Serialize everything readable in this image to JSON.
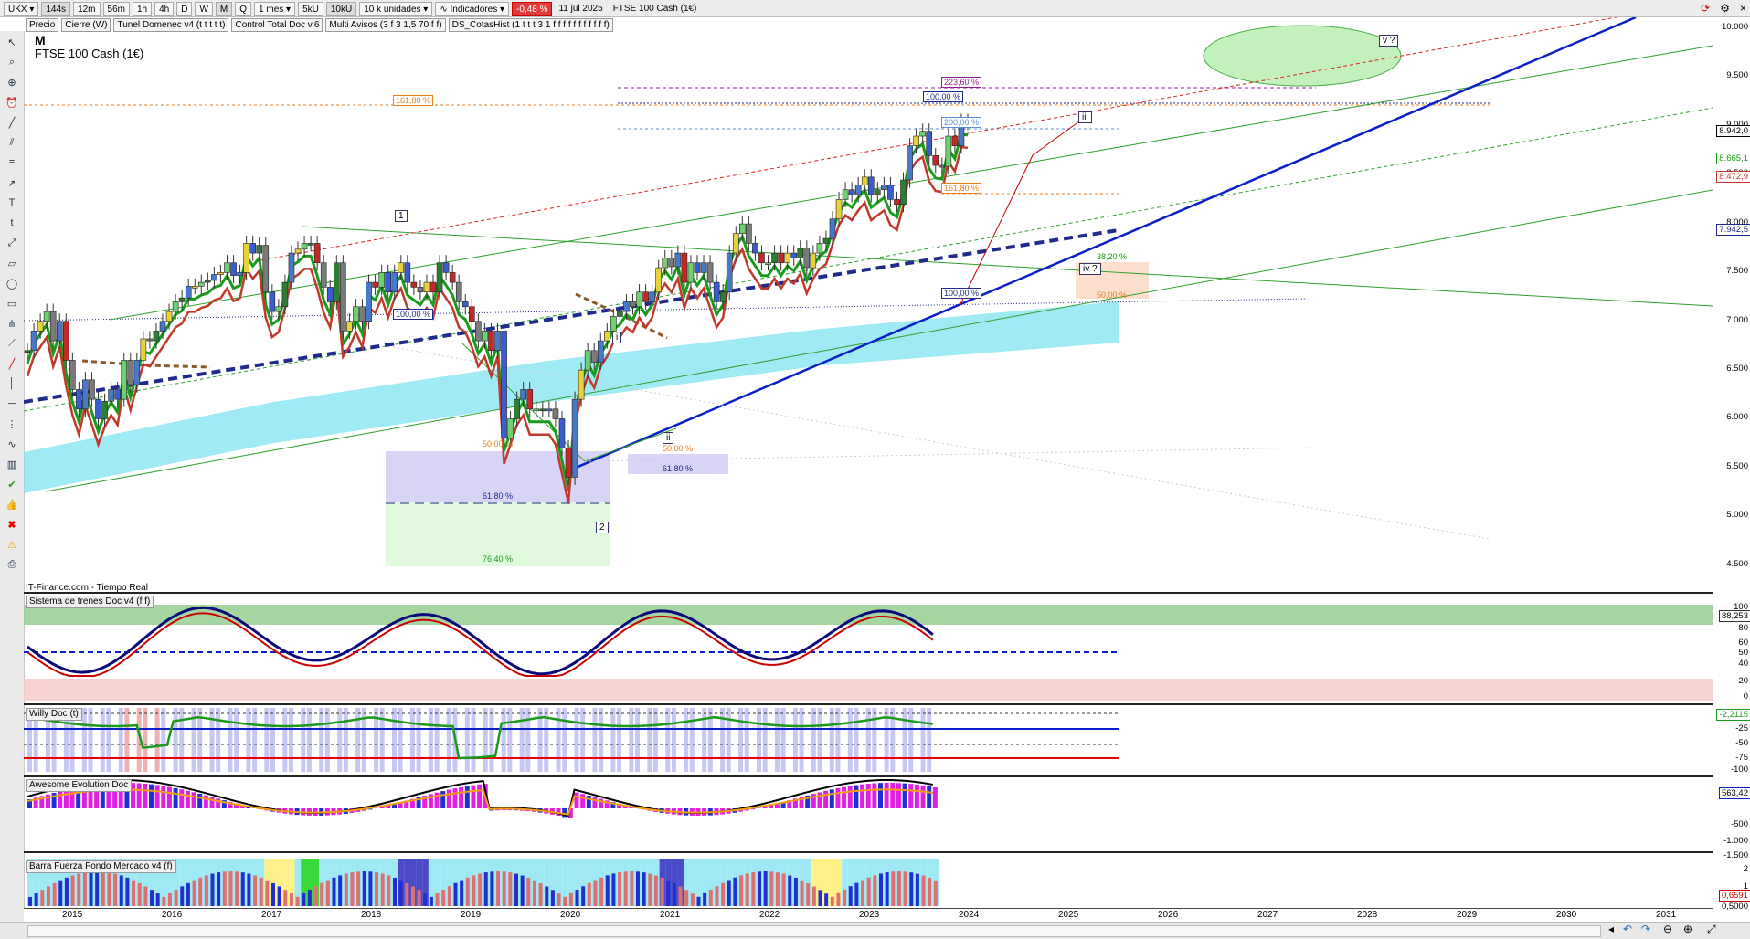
{
  "toolbar": {
    "symbol": "UKX",
    "timeframes": [
      "144s",
      "12m",
      "56m",
      "1h",
      "4h",
      "D",
      "W",
      "M",
      "Q"
    ],
    "period": "1 mes",
    "units_a": "5kU",
    "units_b": "10kU",
    "units_select": "10 k unidades",
    "indicators_label": "Indicadores",
    "change": "-0,48 %",
    "date": "11 jul 2025",
    "instrument": "FTSE 100 Cash (1€)"
  },
  "indicator_bar": [
    "Precio",
    "Cierre (W)",
    "Tunel Domenec v4 (t t t t t)",
    "Control Total Doc v.6",
    "Multi Avisos (3 f 3 1,5 70 f f)",
    "DS_CotasHist (1 t t t 3 1 f f f f f f f f f f f)"
  ],
  "chart": {
    "period_code": "M",
    "name": "FTSE 100 Cash (1€)",
    "source": "IT-Finance.com - Tiempo Real",
    "price_axis": [
      "10.000",
      "9.500",
      "9.000",
      "8.500",
      "8.000",
      "7.500",
      "7.000",
      "6.500",
      "6.000",
      "5.500",
      "5.000",
      "4.500"
    ],
    "price_tags": [
      {
        "text": "8.942,0",
        "color": "#000000"
      },
      {
        "text": "8.665,1",
        "color": "#1a9a1a"
      },
      {
        "text": "8.472,9",
        "color": "#c0392b"
      },
      {
        "text": "7.942,5",
        "color": "#1f2a8a"
      }
    ],
    "fib_labels": [
      {
        "text": "161,80 %",
        "color": "#e67e22"
      },
      {
        "text": "223,60 %",
        "color": "#8e1e8e"
      },
      {
        "text": "100,00 %",
        "color": "#1f2a8a"
      },
      {
        "text": "200,00 %",
        "color": "#5a8fd0"
      },
      {
        "text": "161,80 %",
        "color": "#e67e22"
      },
      {
        "text": "38,20 %",
        "color": "#1a9a1a"
      },
      {
        "text": "50,00 %",
        "color": "#e67e22"
      },
      {
        "text": "100,00 %",
        "color": "#1f2a8a"
      },
      {
        "text": "100,00 %",
        "color": "#1f2a8a"
      },
      {
        "text": "50,00 %",
        "color": "#e67e22"
      },
      {
        "text": "61,80 %",
        "color": "#1f2a8a"
      },
      {
        "text": "76,40 %",
        "color": "#1a9a1a"
      },
      {
        "text": "50,00 %",
        "color": "#e67e22"
      },
      {
        "text": "61,80 %",
        "color": "#1f2a8a"
      }
    ],
    "wave_labels": [
      "1",
      "2",
      "i",
      "ii",
      "iii",
      "iv ?",
      "v ?"
    ]
  },
  "panels": [
    {
      "title": "Sistema de trenes Doc v4 (f f)",
      "axis": [
        "100",
        "88,253",
        "80",
        "60",
        "50",
        "40",
        "20",
        "0"
      ]
    },
    {
      "title": "Willy Doc (t)",
      "axis": [
        "-2,2115",
        "-25",
        "-50",
        "-75",
        "-100"
      ]
    },
    {
      "title": "Awesome Evolution Doc",
      "axis": [
        "563,42",
        "-500",
        "-1.000",
        "-1.500"
      ]
    },
    {
      "title": "Barra Fuerza Fondo Mercado v4 (f)",
      "axis": [
        "2",
        "1",
        "0,6591",
        "0,5000"
      ]
    }
  ],
  "time_axis": [
    "2015",
    "2016",
    "2017",
    "2018",
    "2019",
    "2020",
    "2021",
    "2022",
    "2023",
    "2024",
    "2025",
    "2026",
    "2027",
    "2028",
    "2029",
    "2030",
    "2031"
  ],
  "colors": {
    "up": "#2e7d32",
    "down": "#c62828",
    "blue_trend": "#0a1ec8",
    "cloud": "#7fe3f0",
    "ellipse": "#b9efb0"
  }
}
